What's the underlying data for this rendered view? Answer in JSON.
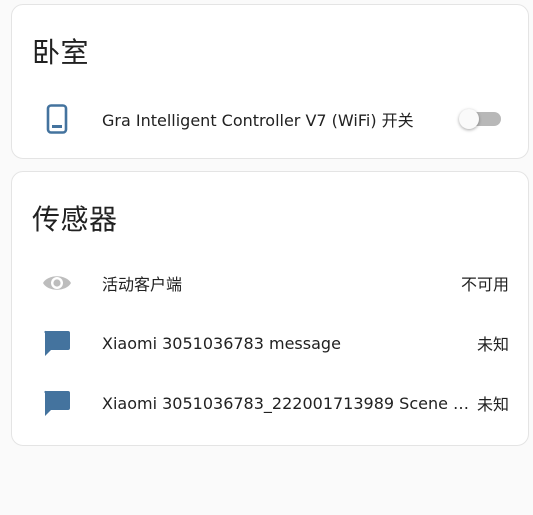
{
  "colors": {
    "icon_blue": "#44739e",
    "icon_grey": "#bdbdbd",
    "toggle_track": "#b8b8b8"
  },
  "bedroom": {
    "title": "卧室",
    "entities": [
      {
        "icon": "cellphone-icon",
        "name": "Gra Intelligent Controller V7 (WiFi) 开关",
        "toggle_on": false
      }
    ]
  },
  "sensors": {
    "title": "传感器",
    "entities": [
      {
        "icon": "eye-icon",
        "name": "活动客户端",
        "state": "不可用"
      },
      {
        "icon": "message-icon",
        "name": "Xiaomi 3051036783 message",
        "state": "未知"
      },
      {
        "icon": "message-icon",
        "name": "Xiaomi 3051036783_222001713989 Scene …",
        "state": "未知"
      }
    ]
  }
}
